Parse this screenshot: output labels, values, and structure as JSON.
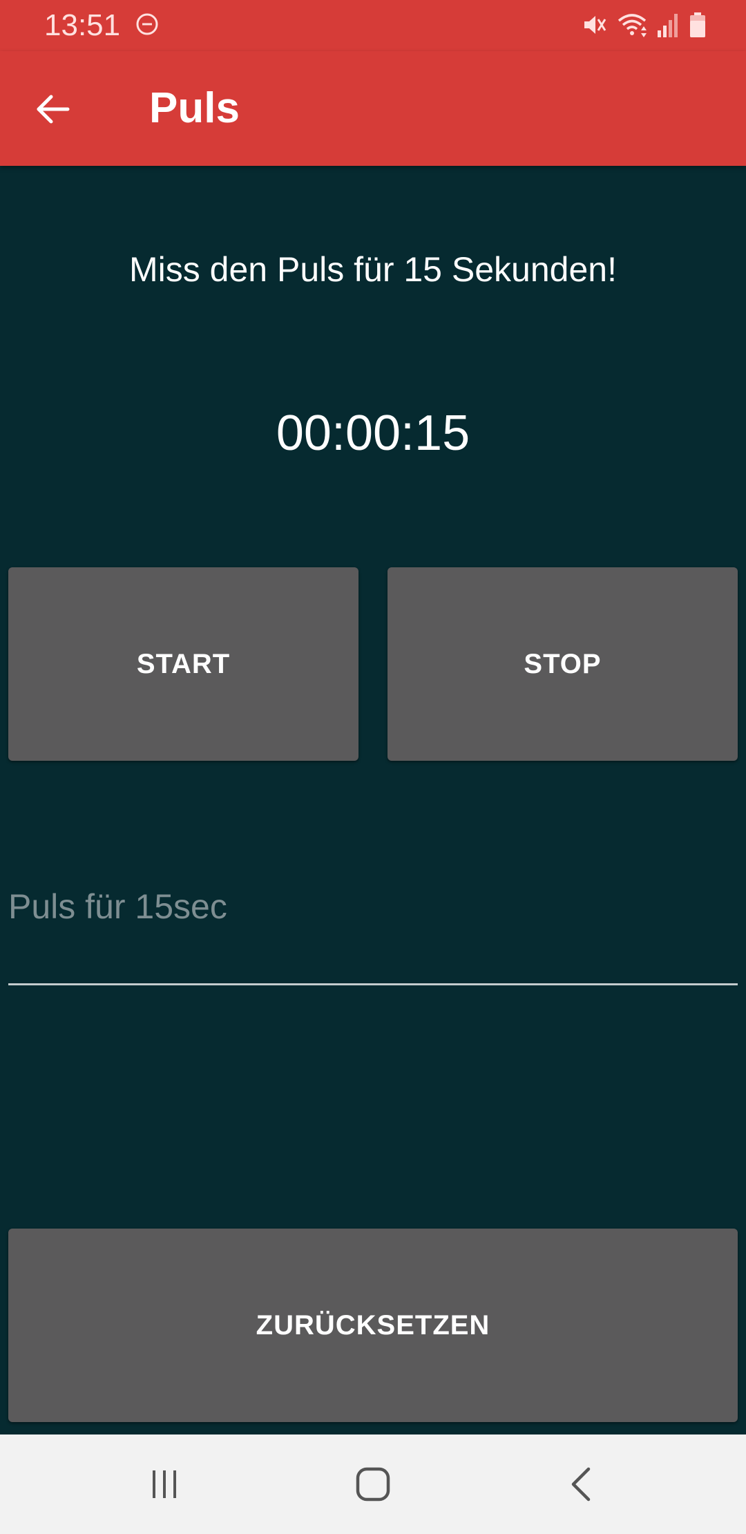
{
  "status_bar": {
    "time": "13:51",
    "icons": [
      "do-not-disturb-icon",
      "mute-icon",
      "wifi-icon",
      "signal-icon",
      "battery-icon"
    ],
    "background_color": "#d63c38"
  },
  "app_bar": {
    "title": "Puls",
    "back_icon": "arrow-left-icon",
    "background_color": "#d63c38"
  },
  "content": {
    "background_color": "#062a30",
    "instruction": "Miss den Puls für 15 Sekunden!",
    "timer": "00:00:15",
    "start_label": "START",
    "stop_label": "STOP",
    "pulse_input": {
      "placeholder": "Puls für 15sec",
      "value": ""
    },
    "reset_label": "ZURÜCKSETZEN",
    "button_color": "#5b5a5b"
  },
  "nav_bar": {
    "icons": [
      "recents-icon",
      "home-icon",
      "back-icon"
    ]
  }
}
